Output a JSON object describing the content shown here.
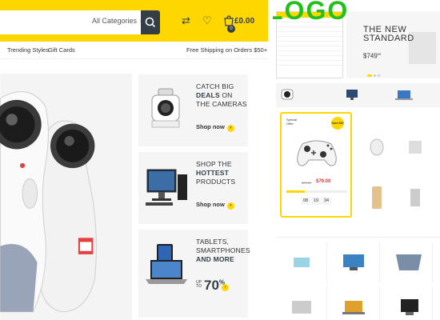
{
  "header": {
    "search_category": "All Categories",
    "cart_count": "0",
    "cart_total": "£0.00"
  },
  "nav": {
    "items": [
      "Trending Styles",
      "Gift Cards"
    ],
    "shipping": "Free Shipping on Orders $50+"
  },
  "promos": [
    {
      "line1": "CATCH BIG",
      "bold1": "DEALS",
      "line2": "ON",
      "line3": "THE CAMERAS",
      "shop": "Shop now"
    },
    {
      "line1": "SHOP THE",
      "bold1": "HOTTEST",
      "line2": "",
      "line3": "PRODUCTS",
      "shop": "Shop now"
    },
    {
      "line1": "TABLETS,",
      "bold1": "",
      "line2": "SMARTPHONES",
      "line3": "AND MORE",
      "upto": "UP TO",
      "discount": "70",
      "discount_unit": "%"
    }
  ],
  "mini": {
    "logo": "LOGO",
    "hero_title_1": "THE NEW",
    "hero_title_2": "STANDARD",
    "hero_price": "$749",
    "hero_price_cents": "99",
    "special": {
      "title_1": "Special",
      "title_2": "Offer",
      "save_badge": "Save $20",
      "old_price": "$99.00",
      "new_price": "$79.00",
      "timer": [
        "08",
        "19",
        "34"
      ]
    }
  },
  "colors": {
    "accent": "#fed700",
    "dark": "#333e48",
    "logo_green": "#22c01a",
    "sale_red": "#df3737"
  }
}
